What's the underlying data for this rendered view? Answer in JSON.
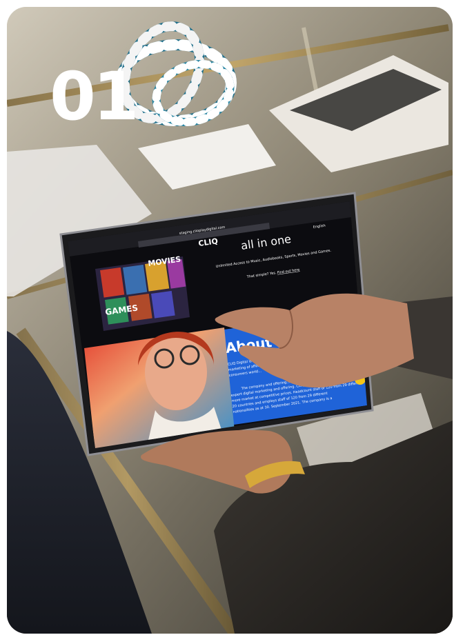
{
  "overlay": {
    "number": "01"
  },
  "tablet": {
    "url_text": "staging.clioplaydigital.com",
    "brand": "CLIQ",
    "language": "English",
    "headline": "all in one",
    "subline": "Unlimited Access to Music, Audiobooks, Sports, Movies and Games.",
    "cta_text": "That simple? Yes.",
    "cta_link": "Find out here",
    "tile_movies": "MOVIES",
    "tile_games": "GAMES",
    "about_heading": "About U",
    "about_body_1": "CLIQ Digital is a streaming provider",
    "about_body_2": "marketing of affordable entertainment",
    "about_body_3": "consumers world...",
    "about_body_4": "The company and offering...",
    "about_body_5": "expert digital marketing and offering. CLIQ Digital operates in over",
    "about_body_6": "more market at competitive prices. Headcount staff of 120 from 29 different",
    "about_body_7": "20 countries and employs staff of 120 from 29 different",
    "about_body_8": "nationalities as at 30. September 2021. The company is a"
  },
  "colors": {
    "accent": "#f5c518",
    "brand_blue": "#1f63d8"
  }
}
